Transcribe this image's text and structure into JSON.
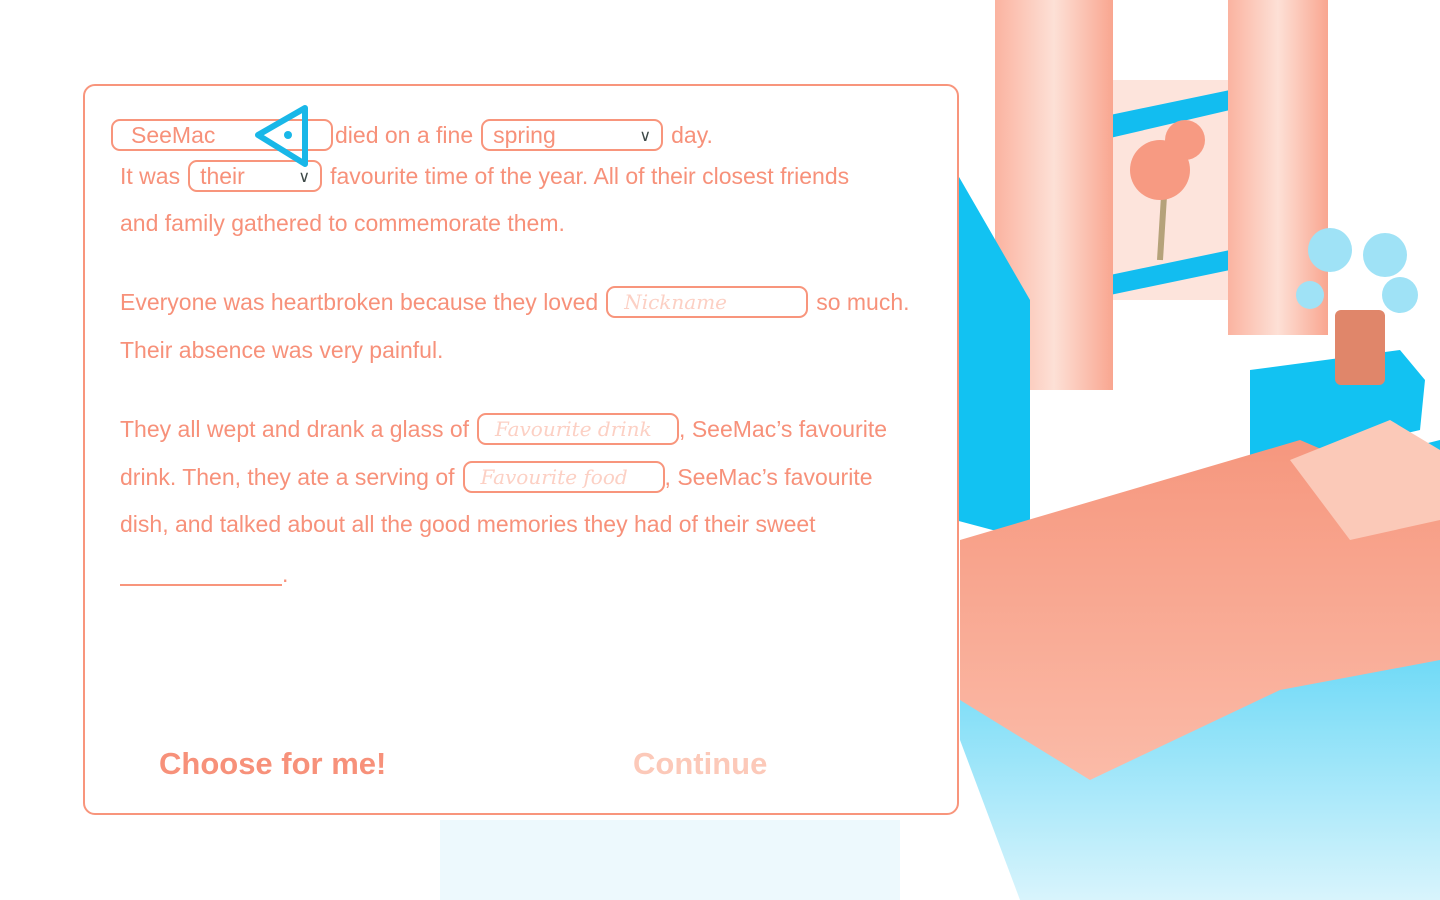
{
  "story": {
    "name_value": "SeeMac",
    "line1_after_name": "died on a fine",
    "season_value": "spring",
    "line1_end": "day.",
    "line2_start": "It was",
    "pronoun_value": "their",
    "line2_end": "favourite time of the year. All of their closest friends",
    "line3": "and family gathered to commemorate them.",
    "line4_start": "Everyone was heartbroken because they loved",
    "nickname_placeholder": "Nickname",
    "line4_end": "so much.",
    "line5": "Their absence was very painful.",
    "line6_start": "They all wept and drank a glass of",
    "drink_placeholder": "Favourite drink",
    "line6_end": ", SeeMac’s favourite",
    "line7_start": "drink. Then, they ate a serving of",
    "food_placeholder": "Favourite food",
    "line7_end": ", SeeMac’s favourite",
    "line8": "dish, and talked about all the good memories they had of their sweet",
    "line9_end": "."
  },
  "buttons": {
    "choose": "Choose for me!",
    "continue": "Continue"
  },
  "colors": {
    "accent": "#f7917a",
    "cursor": "#19b7e8",
    "furniture": "#1cc4f0",
    "disabled": "#fcc9b9"
  }
}
